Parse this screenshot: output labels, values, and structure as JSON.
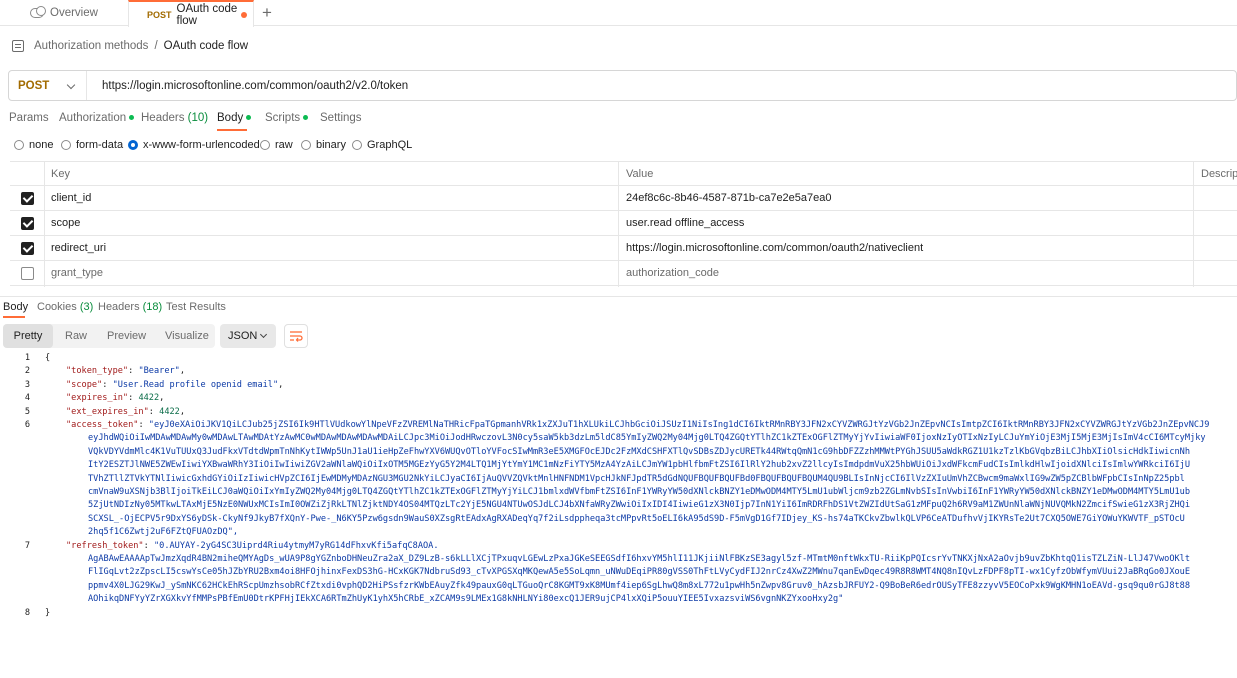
{
  "tabs": {
    "overview": "Overview",
    "active": {
      "method": "POST",
      "label": "OAuth code flow"
    }
  },
  "breadcrumb": {
    "parent": "Authorization methods",
    "separator": "/",
    "current": "OAuth code flow"
  },
  "request": {
    "method": "POST",
    "url": "https://login.microsoftonline.com/common/oauth2/v2.0/token"
  },
  "request_tabs": {
    "params": "Params",
    "authorization": "Authorization",
    "headers": "Headers",
    "headers_count": "(10)",
    "body": "Body",
    "scripts": "Scripts",
    "settings": "Settings"
  },
  "body_types": {
    "none": "none",
    "form_data": "form-data",
    "urlencoded": "x-www-form-urlencoded",
    "raw": "raw",
    "binary": "binary",
    "graphql": "GraphQL"
  },
  "params_table": {
    "headers": {
      "key": "Key",
      "value": "Value",
      "description": "Descript"
    },
    "rows": [
      {
        "key": "client_id",
        "value": "24ef8c6c-8b46-4587-871b-ca7e2e5a7ea0",
        "checked": true
      },
      {
        "key": "scope",
        "value": "user.read offline_access",
        "checked": true
      },
      {
        "key": "redirect_uri",
        "value": "https://login.microsoftonline.com/common/oauth2/nativeclient",
        "checked": true
      },
      {
        "key": "grant_type",
        "value": "authorization_code",
        "checked": false
      }
    ]
  },
  "response_tabs": {
    "body": "Body",
    "cookies": "Cookies",
    "cookies_count": "(3)",
    "headers": "Headers",
    "headers_count": "(18)",
    "test_results": "Test Results"
  },
  "response_toolbar": {
    "pretty": "Pretty",
    "raw": "Raw",
    "preview": "Preview",
    "visualize": "Visualize",
    "format": "JSON"
  },
  "code": {
    "line_numbers": [
      "1",
      "2",
      "3",
      "4",
      "5",
      "6",
      "",
      "",
      "",
      "",
      "",
      "",
      "",
      "",
      "",
      "",
      "",
      "",
      "",
      "",
      "",
      "",
      "",
      "",
      "",
      "",
      "",
      "7",
      "",
      "",
      "",
      "",
      "8"
    ],
    "open_brace": "{",
    "close_brace": "}",
    "token_type_key": "\"token_type\"",
    "token_type_val": "\"Bearer\"",
    "scope_key": "\"scope\"",
    "scope_val": "\"User.Read profile openid email\"",
    "expires_in_key": "\"expires_in\"",
    "expires_in_val": "4422",
    "ext_expires_in_key": "\"ext_expires_in\"",
    "ext_expires_in_val": "4422",
    "access_token_key": "\"access_token\"",
    "access_token_lines": [
      "\"eyJ0eXAiOiJKV1QiLCJub25jZSI6Ik9HTlVUdkowYlNpeVFzZVREMlNaTHRicFpaTGpmanhVRk1xZXJuT1hXLUkiLCJhbGciOiJSUzI1NiIsIng1dCI6IktRMnRBY3JFN2xCYVZWRGJtYzVGb2JnZEpvNCIsImtpZCI6IktRMnRBY3JFN2xCYVZWRGJtYzVGb2JnZEpvNCJ9",
      "eyJhdWQiOiIwMDAwMDAwMy0wMDAwLTAwMDAtYzAwMC0wMDAwMDAwMDAwMDAiLCJpc3MiOiJodHRwczovL3N0cy5saW5kb3dzLm5ldC85YmIyZWQ2My04Mjg0LTQ4ZGQtYTlhZC1kZTExOGFlZTMyYjYvIiwiaWF0IjoxNzIyOTIxNzIyLCJuYmYiOjE3MjI5MjE3MjIsImV4cCI6MTcyMjky",
      "VQkVDYVdmMlc4K1VuTUUxQ3JudFkxVTdtdWpmTnNhKytIWWp5UnJ1aU1ieHpZeFhwYXV6WUQvOTloYVFocSIwMmR3eE5XMGFOcEJDc2FzMXdCSHFXTlQvSDBsZDJycURETk44RWtqQmN1cG9hbDFZZzhMMWtPYGhJSUU5aWdkRGZ1U1kzTzlKbGVqbzBiLCJhbXIiOlsicHdkIiwicnNh",
      "ItY2ESZTJlNWE5ZWEwIiwiYXBwaWRhY3IiOiIwIiwiZGV2aWNlaWQiOiIxOTM5MGEzYyG5Y2M4LTQ1MjYtYmY1MC1mNzFiYTY5MzA4YzAiLCJmYW1pbHlfbmFtZSI6IlRlY2hub2xvZ2llcyIsImdpdmVuX25hbWUiOiJxdWFkcmFudCIsImlkdHlwIjoidXNlciIsImlwYWRkciI6IjU",
      "TVhZTllZTVkYTNlIiwicGxhdGYiOiIzIiwicHVpZCI6IjEwMDMyMDAzNGU3MGU2NkYiLCJyaCI6IjAuQVVZQVktMnlHNFNDM1VpcHJkNFJpdTR5dGdNQUFBQUFBQUFBd0FBQUFBQUFBQUM4QU9BLIsInNjcCI6IlVzZXIuUmVhZCBwcm9maWxlIG9wZW5pZCBlbWFpbCIsInNpZ25pbl",
      "cmVnaW9uXSNjb3BlIjoiTkEiLCJ0aWQiOiIxYmIyZWQ2My04Mjg0LTQ4ZGQtYTlhZC1kZTExOGFlZTMyYjYiLCJ1bmlxdWVfbmFtZSI6InF1YWRyYW50dXNlckBNZY1eDMwODM4MTY5LmU1ubWljcm9zb2ZGLmNvbSIsInVwbiI6InF1YWRyYW50dXNlckBNZY1eDMwODM4MTY5LmU1ub",
      "5ZjUtNDIzNy05MTkwLTAxMjE5NzE0NWUxMCIsImI0OWZiZjRkLTNlZjktNDY4OS04MTQzLTc2YjE5NGU4NTUwOSJdLCJ4bXNfaWRyZWwiOiIxIDI4IiwieG1zX3N0Ijp7InN1YiI6ImRDRFhDS1VtZWZIdUtSaG1zMFpuQ2h6RV9aM1ZWUnNlaWNjNUVQMkN2ZmcifSwieG1zX3RjZHQi",
      "SCXSL_-OjECPV5r9DxYS6yDSk-CkyNf9JkyB7fXQnY-Pwe-_N6KY5Pzw6gsdn9WauS0XZsgRtEAdxAgRXADeqYq7f2iLsdppheqa3tcMPpvRt5oELI6kA95dS9D-F5mVgD1Gf7IDjey_KS-hs74aTKCkvZbwlkQLVP6CeATDufhvVjIKYRsTe2Ut7CXQ5OWE7GiYOWuYKWVTF_pSTOcU",
      "2hq5f1C6Zwtj2uF6FZtQFUAOzDQ\","
    ],
    "refresh_token_key": "\"refresh_token\"",
    "refresh_token_lines": [
      "\"0.AUYAY-2yG4SC3Uiprd4Riu4ytmyM7yRG14dFhxvKfi5afqC8AOA.",
      "AgABAwEAAAApTwJmzXqdR4BN2miheQMYAgDs_wUA9P8gYGZnboDHNeuZra2aX_DZ9LzB-s6kLLlXCjTPxuqvLGEwLzPxaJGKeSEEGSdfI6hxvYM5hlI11JKjiiNlFBKzSE3agyl5zf-MTmtM0nftWkxTU-RiiKpPQIcsrYvTNKXjNxA2aOvjb9uvZbKhtqQ1isTZLZiN-LlJ47VwoOKlt",
      "FlIGqLvt2zZpscLI5cswYsCe05hJZbYRU2Bxm4oi8HFOjhinxFexDS3hG-HCxKGK7NdbruSd93_cTvXPGSXqMKQewA5e5SoLqmn_uNWuDEqiPR80gVSS0ThFtLVyCydFIJ2nrCz4XwZ2MWnu7qanEwDqec49R8R8WMT4NQ8nIQvLzFDPF8pTI-wx1CyfzObWfymVUui2JaBRqGo0JXouE",
      "ppmv4X0LJG29KwJ_ySmNKC62HCkEhRScpUmzhsobRCfZtxdi0vphQD2HiPSsfzrKWbEAuyZfk49pauxG0qLTGuoQrC8KGMT9xK8MUmf4iep6SgLhwQ8m8xL772u1pwHh5nZwpv8Gruv0_hAzsbJRFUY2-Q9BoBeR6edrOUSyTFE8zzyvV5EOCoPxk9WgKMHN1oEAVd-gsq9qu0rGJ8t88",
      "AOhikqDNFYyYZrXGXkvYfMMPsPBfEmU0DtrKPFHjIEkXCA6RTmZhUyK1yhX5hCRbE_xZCAM9s9LMEx1G8kNHLNYi80excQ1JER9ujCP4lxXQiP5ouuYIEE5IvxazsviWS6vgnNKZYxooHxy2g\""
    ]
  }
}
